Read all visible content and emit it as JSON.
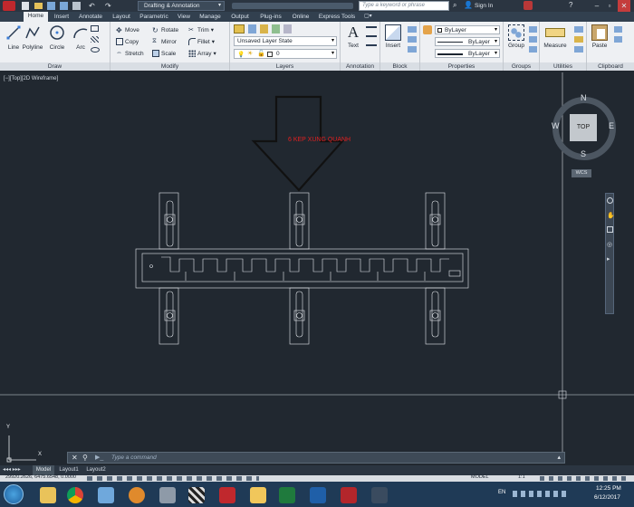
{
  "titlebar": {
    "workspace": "Drafting & Annotation",
    "search_placeholder": "Type a keyword or phrase",
    "sign_in": "Sign In"
  },
  "ribbon_tabs": [
    "Home",
    "Insert",
    "Annotate",
    "Layout",
    "Parametric",
    "View",
    "Manage",
    "Output",
    "Plug-ins",
    "Online",
    "Express Tools"
  ],
  "panels": {
    "draw": {
      "title": "Draw",
      "tools": [
        "Line",
        "Polyline",
        "Circle",
        "Arc"
      ]
    },
    "modify": {
      "title": "Modify",
      "tools": [
        "Move",
        "Rotate",
        "Trim",
        "Copy",
        "Mirror",
        "Fillet",
        "Stretch",
        "Scale",
        "Array"
      ]
    },
    "layers": {
      "title": "Layers",
      "layer_state": "Unsaved Layer State",
      "current_layer": "0"
    },
    "annotation": {
      "title": "Annotation",
      "text": "Text"
    },
    "block": {
      "title": "Block",
      "insert": "Insert"
    },
    "properties": {
      "title": "Properties",
      "color": "ByLayer",
      "linetype": "ByLayer",
      "lineweight": "ByLayer"
    },
    "groups": {
      "title": "Groups",
      "group": "Group"
    },
    "utilities": {
      "title": "Utilities",
      "measure": "Measure"
    },
    "clipboard": {
      "title": "Clipboard",
      "paste": "Paste"
    }
  },
  "viewport": {
    "label": "[−][Top][2D Wireframe]",
    "annotation_text": "6 KEP XUNG QUANH",
    "annotation_color": "#e02020"
  },
  "viewcube": {
    "north": "N",
    "south": "S",
    "east": "E",
    "west": "W",
    "face": "TOP",
    "wcs": "WCS"
  },
  "ucs": {
    "x": "X",
    "y": "Y"
  },
  "command": {
    "placeholder": "Type a command"
  },
  "layout_tabs": [
    "Model",
    "Layout1",
    "Layout2"
  ],
  "status": {
    "coordinates": "29920.2626, 6475.6548, 0.0000",
    "model": "MODEL",
    "scale": "1:1"
  },
  "taskbar": {
    "language": "EN",
    "time": "12:25 PM",
    "date": "6/12/2017"
  }
}
